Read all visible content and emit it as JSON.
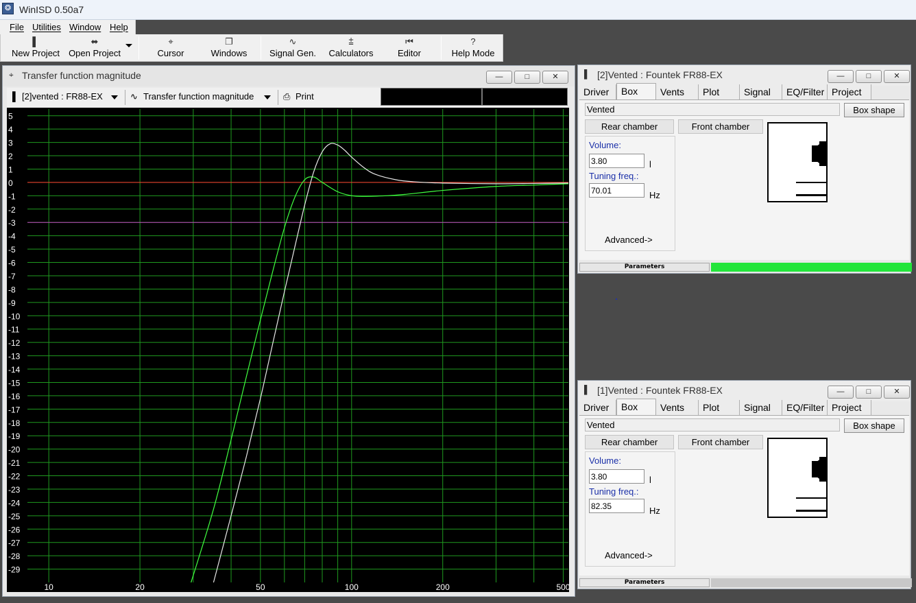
{
  "app": {
    "title": "WinISD 0.50a7"
  },
  "menu": [
    "File",
    "Utilities",
    "Window",
    "Help"
  ],
  "toolbar": {
    "buttons": [
      {
        "label": "New Project",
        "icon": "new-project-icon"
      },
      {
        "label": "Open Project",
        "icon": "open-folder-icon"
      },
      {
        "label": "Cursor",
        "icon": "crosshair-icon"
      },
      {
        "label": "Windows",
        "icon": "windows-icon"
      },
      {
        "label": "Signal Gen.",
        "icon": "sine-wave-icon"
      },
      {
        "label": "Calculators",
        "icon": "calculator-icon"
      },
      {
        "label": "Editor",
        "icon": "editor-icon"
      },
      {
        "label": "Help Mode",
        "icon": "question-icon"
      }
    ]
  },
  "graph": {
    "title": "Transfer function magnitude",
    "project_select": "[2]vented : FR88-EX",
    "plot_select": "Transfer function magnitude",
    "print_label": "Print",
    "controls": {
      "minimize": "—",
      "maximize": "□",
      "close": "✕"
    }
  },
  "chart_data": {
    "type": "line",
    "xscale": "log",
    "xlim": [
      8.5,
      520
    ],
    "ylim": [
      -30,
      5.5
    ],
    "x_ticks": [
      10,
      20,
      50,
      100,
      200,
      500
    ],
    "x_gridlines": [
      10,
      20,
      30,
      40,
      50,
      60,
      70,
      80,
      90,
      100,
      200,
      300,
      400,
      500
    ],
    "y_ticks": [
      5,
      4,
      3,
      2,
      1,
      0,
      -1,
      -2,
      -3,
      -4,
      -5,
      -6,
      -7,
      -8,
      -9,
      -10,
      -11,
      -12,
      -13,
      -14,
      -15,
      -16,
      -17,
      -18,
      -19,
      -20,
      -21,
      -22,
      -23,
      -24,
      -25,
      -26,
      -27,
      -28,
      -29
    ],
    "reference_lines": [
      {
        "y": 0,
        "color": "#ff3030"
      },
      {
        "y": -3,
        "color": "#c040c0"
      }
    ],
    "grid": true,
    "grid_color": "#1f9a1f",
    "series": [
      {
        "color": "#40ff40",
        "x": [
          29.5,
          35,
          40,
          45,
          50,
          55,
          60,
          65,
          70,
          75,
          80,
          90,
          100,
          110,
          130,
          150,
          200,
          300,
          400,
          520
        ],
        "y": [
          -30,
          -24.5,
          -19.3,
          -14.5,
          -10.3,
          -6.6,
          -3.4,
          -1.1,
          0.2,
          0.4,
          0,
          -0.7,
          -1.0,
          -1.05,
          -1.0,
          -0.9,
          -0.6,
          -0.3,
          -0.2,
          -0.1
        ]
      },
      {
        "color": "#e8e8e8",
        "x": [
          35,
          40,
          45,
          50,
          55,
          60,
          65,
          70,
          75,
          80,
          85,
          90,
          95,
          100,
          110,
          120,
          140,
          160,
          200,
          300,
          400,
          520
        ],
        "y": [
          -30,
          -25,
          -20.5,
          -16.2,
          -12,
          -8.2,
          -4.8,
          -1.7,
          0.8,
          2.3,
          2.9,
          2.8,
          2.4,
          1.9,
          1.1,
          0.6,
          0.2,
          0.05,
          -0.05,
          -0.1,
          -0.08,
          -0.05
        ]
      }
    ]
  },
  "box_windows": [
    {
      "title": "[2]Vented : Fountek FR88-EX",
      "tabs": [
        "Driver",
        "Box",
        "Vents",
        "Plot",
        "Signal",
        "EQ/Filter",
        "Project"
      ],
      "active_tab": "Box",
      "box_type": "Vented",
      "box_shape_label": "Box shape",
      "rear_chamber_label": "Rear chamber",
      "front_chamber_label": "Front chamber",
      "volume_label": "Volume:",
      "volume_value": "3.80",
      "volume_unit": "l",
      "tuning_label": "Tuning freq.:",
      "tuning_value": "70.01",
      "tuning_unit": "Hz",
      "advanced_label": "Advanced->",
      "status_label": "Parameters",
      "status_color": "#22e53a"
    },
    {
      "title": "[1]Vented : Fountek FR88-EX",
      "tabs": [
        "Driver",
        "Box",
        "Vents",
        "Plot",
        "Signal",
        "EQ/Filter",
        "Project"
      ],
      "active_tab": "Box",
      "box_type": "Vented",
      "box_shape_label": "Box shape",
      "rear_chamber_label": "Rear chamber",
      "front_chamber_label": "Front chamber",
      "volume_label": "Volume:",
      "volume_value": "3.80",
      "volume_unit": "l",
      "tuning_label": "Tuning freq.:",
      "tuning_value": "82.35",
      "tuning_unit": "Hz",
      "advanced_label": "Advanced->",
      "status_label": "Parameters",
      "status_color": "#c8c8c8"
    }
  ]
}
